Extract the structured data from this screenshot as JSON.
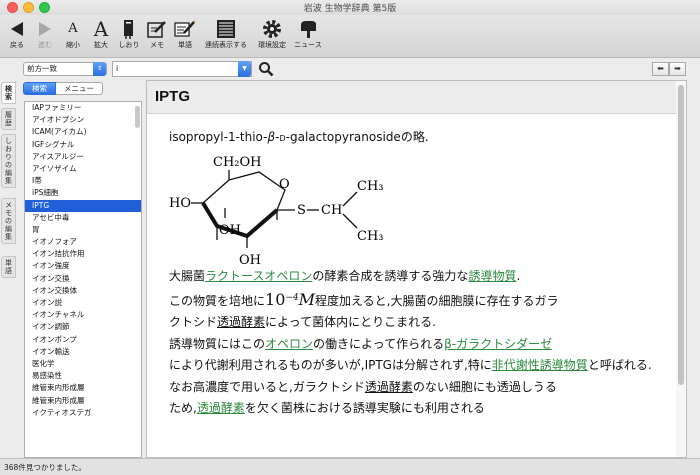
{
  "window": {
    "title": "岩波 生物学辞典 第5版"
  },
  "toolbar": {
    "back": "戻る",
    "forward": "進む",
    "shrink": "縮小",
    "enlarge": "拡大",
    "bookmark": "しおり",
    "memo": "メモ",
    "wordbook": "単語",
    "continuous": "連続表示する",
    "settings": "環境設定",
    "news": "ニュース"
  },
  "search": {
    "mode": "前方一致",
    "query": "i"
  },
  "side_tabs": [
    "検索",
    "履歴",
    "しおりの編集",
    "メモの編集",
    "単語"
  ],
  "left": {
    "seg_search": "検索",
    "seg_menu": "メニュー",
    "results": [
      "IAPファミリー",
      "アイオドプシン",
      "ICAM(アイカム)",
      "IGFシグナル",
      "アイスアルジー",
      "アイソザイム",
      "I帯",
      "iPS細胞",
      "IPTG",
      "アセビ中毒",
      "胃",
      "イオノフォア",
      "イオン拮抗作用",
      "イオン強度",
      "イオン交換",
      "イオン交換体",
      "イオン説",
      "イオンチャネル",
      "イオン調節",
      "イオンポンプ",
      "イオン輸送",
      "医化学",
      "易感染性",
      "維管束内形成層",
      "維管束内形成層",
      "イクティオステガ"
    ],
    "selected_index": 8
  },
  "status": {
    "text": "368件見つかりました。"
  },
  "entry": {
    "title": "IPTG",
    "intro_a": "isopropyl-1-thio-",
    "intro_beta": "β",
    "intro_b": "-",
    "intro_d": "D",
    "intro_c": "-galactopyranosideの略.",
    "molecule": {
      "ch2oh": "CH₂OH",
      "o_ring": "O",
      "ho_left": "HO",
      "oh_mid": "OH",
      "oh_bottom": "OH",
      "s": "S",
      "ch": "CH",
      "ch3_top": "CH₃",
      "ch3_bottom": "CH₃"
    },
    "p1_a": "大腸菌",
    "p1_link1": "ラクトースオペロン",
    "p1_b": "の酵素合成を誘導する強力な",
    "p1_link2": "誘導物質",
    "p1_c": ".",
    "p2_a": "この物質を培地に",
    "p2_num": "10",
    "p2_exp": "−4",
    "p2_unit": "M",
    "p2_b": "程度加えると,大腸菌の細胞膜に存在するガラ",
    "p2_c": "クトシド",
    "p2_u1": "透過酵素",
    "p2_d": "によって菌体内にとりこまれる.",
    "p3_a": "誘導物質にはこの",
    "p3_link1": "オペロン",
    "p3_b": "の働きによって作られる",
    "p3_link2": "β-ガラクトシダーゼ",
    "p3_c": "により代謝利用されるものが多いが,IPTGは分解されず,特に",
    "p3_link3": "非代謝性誘導物質",
    "p3_d": "と呼ばれる.",
    "p4_a": "なお高濃度で用いると,ガラクトシド",
    "p4_u1": "透過酵素",
    "p4_b": "のない細胞にも透過しうる",
    "p4_c": "ため,",
    "p4_link1": "透過酵素",
    "p4_d": "を欠く菌株における誘導実験にも利用される"
  }
}
